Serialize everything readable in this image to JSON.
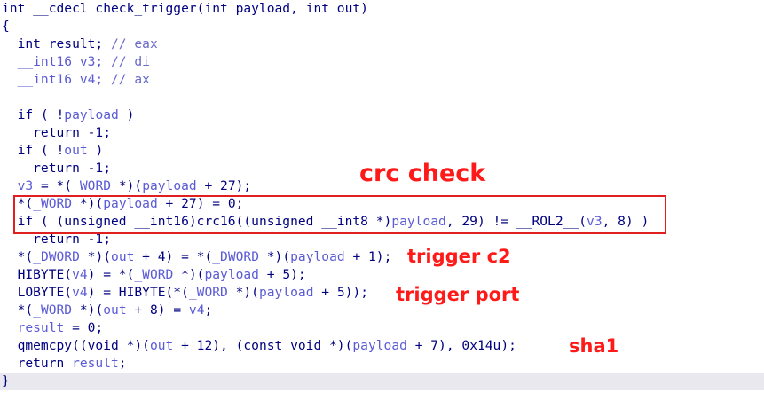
{
  "lines": [
    {
      "segs": [
        {
          "t": "int __cdecl check_trigger(int payload, int out)"
        }
      ]
    },
    {
      "segs": [
        {
          "t": "{"
        }
      ]
    },
    {
      "segs": [
        {
          "t": "  int result; "
        },
        {
          "t": "// eax",
          "k": "c"
        }
      ]
    },
    {
      "segs": [
        {
          "t": "  __int16 v3; ",
          "k": "v"
        },
        {
          "t": "// di",
          "k": "c"
        }
      ]
    },
    {
      "segs": [
        {
          "t": "  __int16 v4; ",
          "k": "v"
        },
        {
          "t": "// ax",
          "k": "c"
        }
      ]
    },
    {
      "segs": [
        {
          "t": ""
        }
      ]
    },
    {
      "segs": [
        {
          "t": "  if ( !"
        },
        {
          "t": "payload",
          "k": "v"
        },
        {
          "t": " )"
        }
      ]
    },
    {
      "segs": [
        {
          "t": "    return -1;"
        }
      ]
    },
    {
      "segs": [
        {
          "t": "  if ( !"
        },
        {
          "t": "out",
          "k": "v"
        },
        {
          "t": " )"
        }
      ]
    },
    {
      "segs": [
        {
          "t": "    return -1;"
        }
      ]
    },
    {
      "segs": [
        {
          "t": "  "
        },
        {
          "t": "v3",
          "k": "v"
        },
        {
          "t": " = *("
        },
        {
          "t": "_WORD",
          "k": "v"
        },
        {
          "t": " *)("
        },
        {
          "t": "payload",
          "k": "v"
        },
        {
          "t": " + 27);"
        }
      ]
    },
    {
      "segs": [
        {
          "t": "  *("
        },
        {
          "t": "_WORD",
          "k": "v"
        },
        {
          "t": " *)("
        },
        {
          "t": "payload",
          "k": "v"
        },
        {
          "t": " + 27) = 0;"
        }
      ]
    },
    {
      "segs": [
        {
          "t": "  if ( (unsigned __int16)crc16((unsigned __int8 *)"
        },
        {
          "t": "payload",
          "k": "v"
        },
        {
          "t": ", 29) != __ROL2__("
        },
        {
          "t": "v3",
          "k": "v"
        },
        {
          "t": ", 8) )"
        }
      ]
    },
    {
      "segs": [
        {
          "t": "    return -1;"
        }
      ]
    },
    {
      "segs": [
        {
          "t": "  *("
        },
        {
          "t": "_DWORD",
          "k": "v"
        },
        {
          "t": " *)("
        },
        {
          "t": "out",
          "k": "v"
        },
        {
          "t": " + 4) = *("
        },
        {
          "t": "_DWORD",
          "k": "v"
        },
        {
          "t": " *)("
        },
        {
          "t": "payload",
          "k": "v"
        },
        {
          "t": " + 1);"
        }
      ]
    },
    {
      "segs": [
        {
          "t": "  HIBYTE("
        },
        {
          "t": "v4",
          "k": "v"
        },
        {
          "t": ") = *("
        },
        {
          "t": "_WORD",
          "k": "v"
        },
        {
          "t": " *)("
        },
        {
          "t": "payload",
          "k": "v"
        },
        {
          "t": " + 5);"
        }
      ]
    },
    {
      "segs": [
        {
          "t": "  LOBYTE("
        },
        {
          "t": "v4",
          "k": "v"
        },
        {
          "t": ") = HIBYTE(*("
        },
        {
          "t": "_WORD",
          "k": "v"
        },
        {
          "t": " *)("
        },
        {
          "t": "payload",
          "k": "v"
        },
        {
          "t": " + 5));"
        }
      ]
    },
    {
      "segs": [
        {
          "t": "  *("
        },
        {
          "t": "_WORD",
          "k": "v"
        },
        {
          "t": " *)("
        },
        {
          "t": "out",
          "k": "v"
        },
        {
          "t": " + 8) = "
        },
        {
          "t": "v4",
          "k": "v"
        },
        {
          "t": ";"
        }
      ]
    },
    {
      "segs": [
        {
          "t": "  "
        },
        {
          "t": "result",
          "k": "v"
        },
        {
          "t": " = 0;"
        }
      ]
    },
    {
      "segs": [
        {
          "t": "  qmemcpy((void *)("
        },
        {
          "t": "out",
          "k": "v"
        },
        {
          "t": " + 12), (const void *)("
        },
        {
          "t": "payload",
          "k": "v"
        },
        {
          "t": " + 7), 0x14u);"
        }
      ]
    },
    {
      "segs": [
        {
          "t": "  return "
        },
        {
          "t": "result",
          "k": "v"
        },
        {
          "t": ";"
        }
      ]
    },
    {
      "segs": [
        {
          "t": "}"
        }
      ]
    }
  ],
  "annotations": {
    "crc_check": "crc check",
    "trigger_c2": "trigger c2",
    "trigger_port": "trigger port",
    "sha1": "sha1"
  },
  "colors": {
    "code": "#000080",
    "variable": "#5b5bd6",
    "comment": "#6a6acb",
    "annotation": "#ff1a1a",
    "highlight_box": "#e02020"
  }
}
